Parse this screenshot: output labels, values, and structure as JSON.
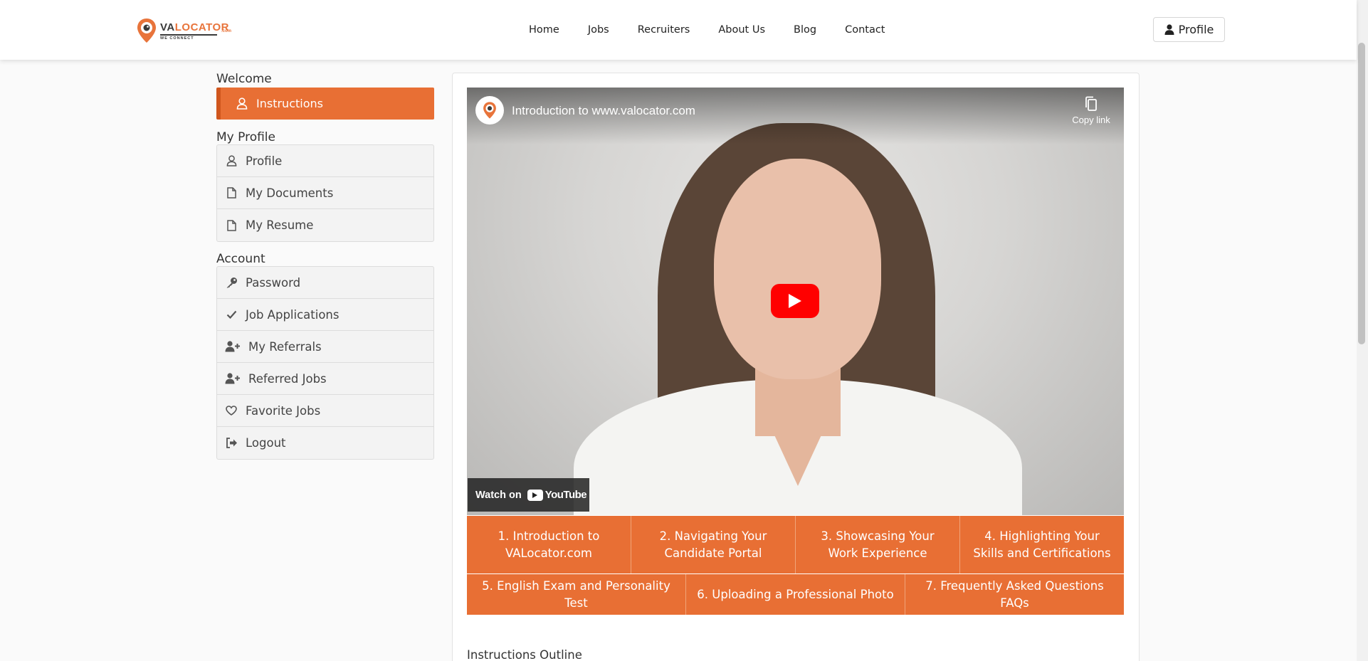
{
  "header": {
    "logo": {
      "brand_primary": "VA",
      "brand_secondary": "LOCATOR",
      "suffix": ".com",
      "tagline": "WE CONNECT"
    },
    "nav": [
      {
        "label": "Home"
      },
      {
        "label": "Jobs"
      },
      {
        "label": "Recruiters"
      },
      {
        "label": "About Us"
      },
      {
        "label": "Blog"
      },
      {
        "label": "Contact"
      }
    ],
    "profile_button": {
      "label": "Profile",
      "icon": "user-icon"
    }
  },
  "sidebar": {
    "welcome_heading": "Welcome",
    "active_item": {
      "label": "Instructions",
      "icon": "user-icon"
    },
    "profile_heading": "My Profile",
    "profile_items": [
      {
        "label": "Profile",
        "icon": "user-icon"
      },
      {
        "label": "My Documents",
        "icon": "document-icon"
      },
      {
        "label": "My Resume",
        "icon": "document-icon"
      }
    ],
    "account_heading": "Account",
    "account_items": [
      {
        "label": "Password",
        "icon": "key-icon"
      },
      {
        "label": "Job Applications",
        "icon": "check-icon"
      },
      {
        "label": "My Referrals",
        "icon": "user-plus-icon"
      },
      {
        "label": "Referred Jobs",
        "icon": "user-plus-icon"
      },
      {
        "label": "Favorite Jobs",
        "icon": "heart-icon"
      },
      {
        "label": "Logout",
        "icon": "logout-icon"
      }
    ]
  },
  "video": {
    "title": "Introduction to www.valocator.com",
    "copy_link_label": "Copy link",
    "watch_on_label": "Watch on",
    "youtube_label": "YouTube"
  },
  "chapters_row1": [
    {
      "label": "1. Introduction to VALocator.com"
    },
    {
      "label": "2. Navigating Your Candidate Portal"
    },
    {
      "label": "3. Showcasing Your Work Experience"
    },
    {
      "label": "4. Highlighting Your Skills and Certifications"
    }
  ],
  "chapters_row2": [
    {
      "label": "5. English Exam and Personality Test"
    },
    {
      "label": "6. Uploading a Professional Photo"
    },
    {
      "label": "7. Frequently Asked Questions FAQs"
    }
  ],
  "outline_title": "Instructions Outline",
  "colors": {
    "accent": "#e86f34",
    "accent_dark": "#d0561d",
    "youtube_red": "#ff0000"
  }
}
